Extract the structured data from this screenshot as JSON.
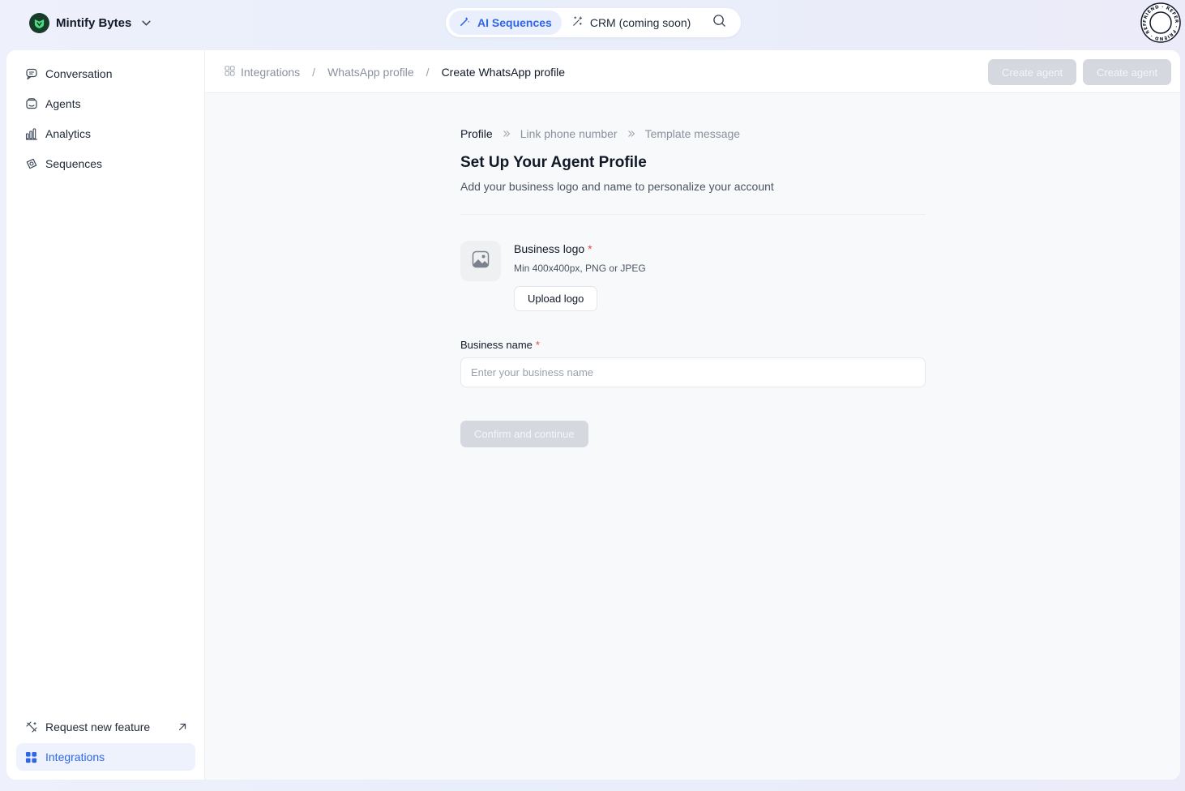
{
  "brand": {
    "name": "Mintify Bytes",
    "logo_icon": "leaf-shield-icon",
    "color": "#173c2a"
  },
  "topnav": {
    "tabs": [
      {
        "label": "AI Sequences",
        "icon": "magic-wand-icon",
        "active": true
      },
      {
        "label": "CRM (coming soon)",
        "icon": "sparkle-wand-icon",
        "active": false
      }
    ],
    "search_icon": "search-icon"
  },
  "refer_badge": {
    "text": "FRIEND · REFER"
  },
  "sidebar": {
    "items": [
      {
        "label": "Conversation",
        "icon": "chat-bubble-icon"
      },
      {
        "label": "Agents",
        "icon": "agent-box-icon"
      },
      {
        "label": "Analytics",
        "icon": "bar-chart-icon"
      },
      {
        "label": "Sequences",
        "icon": "sequence-icon"
      }
    ],
    "bottom": [
      {
        "label": "Request new feature",
        "icon": "wand-icon",
        "trailing_icon": "external-arrow-icon"
      },
      {
        "label": "Integrations",
        "icon": "grid-icon",
        "active": true
      }
    ]
  },
  "header": {
    "breadcrumb": [
      "Integrations",
      "WhatsApp profile",
      "Create WhatsApp profile"
    ],
    "separator": "/",
    "buttons": [
      "Create agent",
      "Create agent"
    ]
  },
  "form": {
    "steps": [
      "Profile",
      "Link phone number",
      "Template message"
    ],
    "title": "Set Up Your Agent Profile",
    "subtitle": "Add your business logo and name to personalize your account",
    "logo": {
      "label": "Business logo",
      "required_mark": "*",
      "hint": "Min 400x400px, PNG or JPEG",
      "upload_label": "Upload logo"
    },
    "business_name": {
      "label": "Business name",
      "required_mark": "*",
      "value": "",
      "placeholder": "Enter your business name"
    },
    "confirm_label": "Confirm and continue"
  },
  "colors": {
    "accent": "#2f66e8",
    "accent_bg": "#e9effc",
    "disabled_button": "#d5d8de",
    "required": "#e5484d"
  }
}
